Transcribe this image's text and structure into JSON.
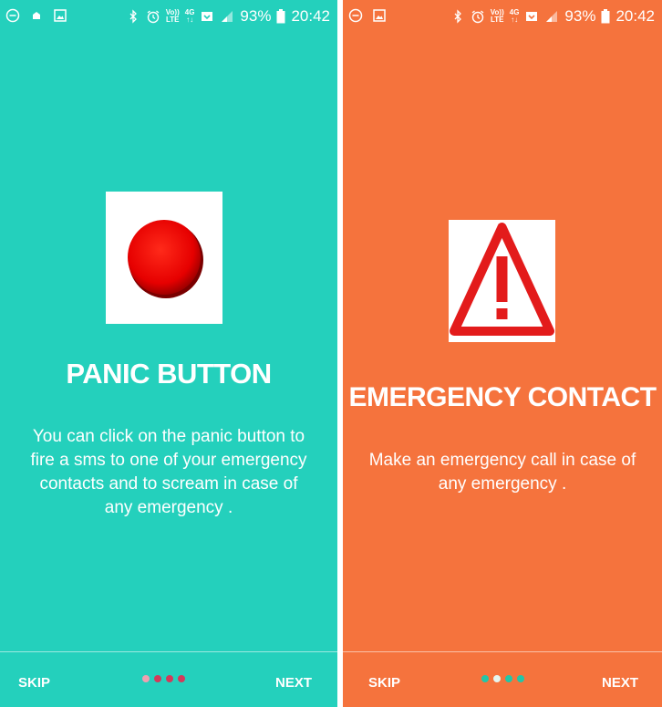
{
  "colors": {
    "panel1_bg": "#24d0bc",
    "panel2_bg": "#f5733d",
    "panel1_dot_active": "#f0a0b0",
    "panel1_dot_inactive": "#d23a5a",
    "panel2_dot_active": "#e6f6f0",
    "panel2_dot_inactive": "#22c6a8"
  },
  "screens": [
    {
      "status": {
        "icons_left": [
          "do-not-disturb-icon",
          "notification-icon",
          "gallery-icon"
        ],
        "icons_right": [
          "bluetooth-icon",
          "alarm-icon",
          "volte-icon",
          "4g-icon",
          "data-saver-icon",
          "signal-icon",
          "battery-icon"
        ],
        "volte_line1": "Vo))",
        "volte_line2": "LTE",
        "net_line1": "4G",
        "net_line2": "↑↓",
        "battery": "93%",
        "time": "20:42"
      },
      "title": "PANIC BUTTON",
      "description": "You can click on the panic button to fire a sms to one of your emergency contacts and to scream in case of any emergency .",
      "skip": "SKIP",
      "next": "NEXT"
    },
    {
      "status": {
        "icons_left": [
          "do-not-disturb-icon",
          "gallery-icon"
        ],
        "icons_right": [
          "bluetooth-icon",
          "alarm-icon",
          "volte-icon",
          "4g-icon",
          "data-saver-icon",
          "signal-icon",
          "battery-icon"
        ],
        "volte_line1": "Vo))",
        "volte_line2": "LTE",
        "net_line1": "4G",
        "net_line2": "↑↓",
        "battery": "93%",
        "time": "20:42"
      },
      "title": "EMERGENCY CONTACT",
      "description": "Make an emergency call in case of any emergency .",
      "skip": "SKIP",
      "next": "NEXT"
    }
  ]
}
